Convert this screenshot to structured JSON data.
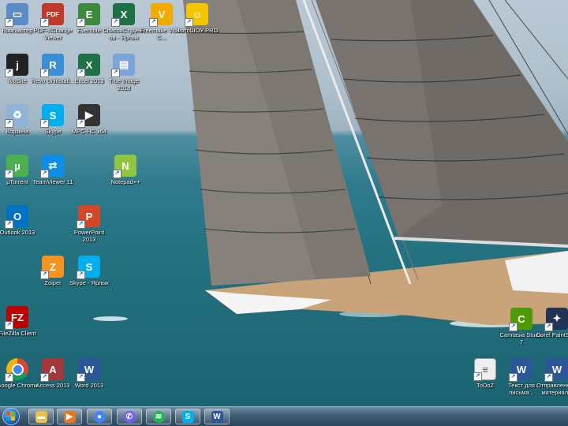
{
  "desktop_icons": [
    {
      "label": "Компьютер",
      "icon": "computer-icon",
      "color": "#5b8cc8"
    },
    {
      "label": "PDF-XChange Viewer",
      "icon": "pdf-xchange-icon",
      "color": "#c0392b"
    },
    {
      "label": "Evernote",
      "icon": "evernote-icon",
      "color": "#3b8a3e"
    },
    {
      "label": "СписокСтудентов - Ярлык",
      "icon": "excel-file-icon",
      "color": "#1e7145"
    },
    {
      "label": "Freemake Video C...",
      "icon": "freemake-icon",
      "color": "#f2a900"
    },
    {
      "label": "ФотоШОУ PRO",
      "icon": "fotoshow-icon",
      "color": "#f5c400"
    },
    {
      "label": "iVoSite",
      "icon": "ivosite-icon",
      "color": "#222222"
    },
    {
      "label": "Revo Uninstall...",
      "icon": "revo-uninstaller-icon",
      "color": "#3a8fd8"
    },
    {
      "label": "Excel 2013",
      "icon": "excel-icon",
      "color": "#1e7145"
    },
    {
      "label": "True Image 2018",
      "icon": "true-image-icon",
      "color": "#7aa5d8"
    },
    {
      "label": "Корзина",
      "icon": "recycle-bin-icon",
      "color": "#8fb4d8"
    },
    {
      "label": "Skype",
      "icon": "skype-icon",
      "color": "#00aff0"
    },
    {
      "label": "MPC-HC x64",
      "icon": "mpc-hc-icon",
      "color": "#333333"
    },
    {
      "label": "µTorrent",
      "icon": "utorrent-icon",
      "color": "#4caf50"
    },
    {
      "label": "TeamViewer 11",
      "icon": "teamviewer-icon",
      "color": "#0e8ee9"
    },
    {
      "label": "Notepad++",
      "icon": "notepadpp-icon",
      "color": "#90c53f"
    },
    {
      "label": "Outlook 2013",
      "icon": "outlook-icon",
      "color": "#0072c6"
    },
    {
      "label": "PowerPoint 2013",
      "icon": "powerpoint-icon",
      "color": "#d24726"
    },
    {
      "label": "Zoiper",
      "icon": "zoiper-icon",
      "color": "#f7931e"
    },
    {
      "label": "Skype - Ярлык",
      "icon": "skype-shortcut-icon",
      "color": "#00aff0"
    },
    {
      "label": "FileZilla Client",
      "icon": "filezilla-icon",
      "color": "#bf0000"
    },
    {
      "label": "Google Chrome",
      "icon": "chrome-icon",
      "color": "#4285f4"
    },
    {
      "label": "Access 2013",
      "icon": "access-icon",
      "color": "#a4373a"
    },
    {
      "label": "Word 2013",
      "icon": "word-icon",
      "color": "#2b579a"
    },
    {
      "label": "Camtasia Studio 7",
      "icon": "camtasia-icon",
      "color": "#4e9a06"
    },
    {
      "label": "Corel PaintSh...",
      "icon": "corel-paintshop-icon",
      "color": "#223355"
    },
    {
      "label": "ToDoZ",
      "icon": "text-file-icon",
      "color": "#eeeeee"
    },
    {
      "label": "Текст для письма...",
      "icon": "word-doc-icon",
      "color": "#2b579a"
    },
    {
      "label": "Отправленные материалы",
      "icon": "word-doc-icon-2",
      "color": "#2b579a"
    }
  ],
  "taskbar": {
    "start": {
      "icon": "windows-start-icon"
    },
    "items": [
      {
        "name": "explorer",
        "icon": "folder-icon",
        "color": "#e8c04a"
      },
      {
        "name": "media-player",
        "icon": "media-player-icon",
        "color": "#e87722"
      },
      {
        "name": "chrome",
        "icon": "chrome-icon",
        "color": "#4285f4"
      },
      {
        "name": "viber",
        "icon": "viber-icon",
        "color": "#7360f2"
      },
      {
        "name": "spotify",
        "icon": "spotify-icon",
        "color": "#1db954"
      },
      {
        "name": "skype",
        "icon": "skype-icon",
        "color": "#00aff0"
      },
      {
        "name": "word",
        "icon": "word-icon",
        "color": "#2b579a"
      }
    ]
  }
}
